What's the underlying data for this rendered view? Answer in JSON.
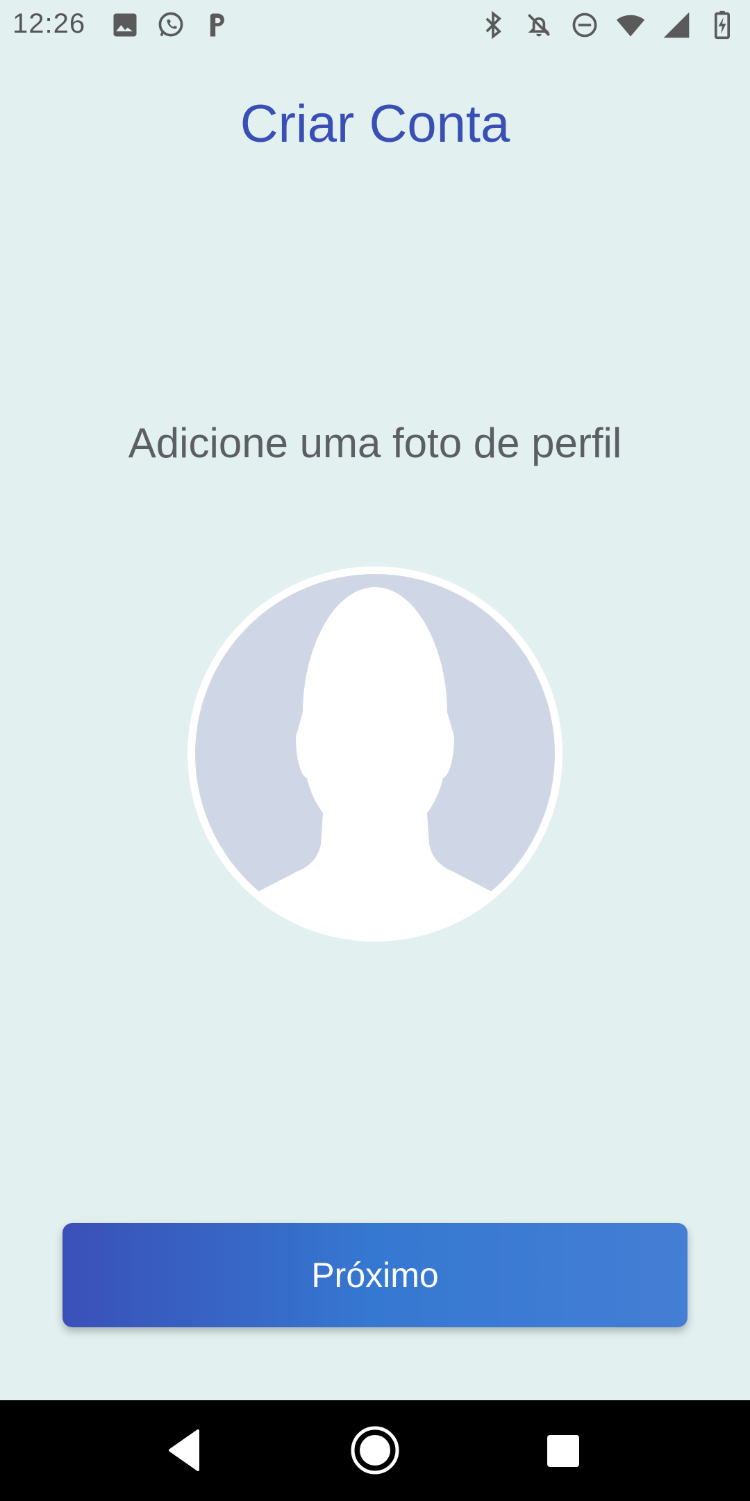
{
  "status_bar": {
    "time": "12:26",
    "left_icons": [
      "image-icon",
      "whatsapp-icon",
      "parking-icon"
    ],
    "right_icons": [
      "bluetooth-icon",
      "notifications-off-icon",
      "do-not-disturb-icon",
      "wifi-icon",
      "cell-signal-icon",
      "battery-icon"
    ]
  },
  "header": {
    "title": "Criar Conta"
  },
  "main": {
    "subtitle": "Adicione uma foto de perfil",
    "avatar_icon": "profile-placeholder-icon"
  },
  "footer": {
    "next_label": "Próximo"
  },
  "nav_bar": {
    "icons": [
      "back-icon",
      "home-icon",
      "recents-icon"
    ]
  },
  "colors": {
    "background": "#e2f0f0",
    "title": "#3a4fb5",
    "subtitle": "#5b5f63",
    "avatar_bg": "#cfd6e6",
    "button_start": "#3a50b8",
    "button_end": "#457ed4"
  }
}
